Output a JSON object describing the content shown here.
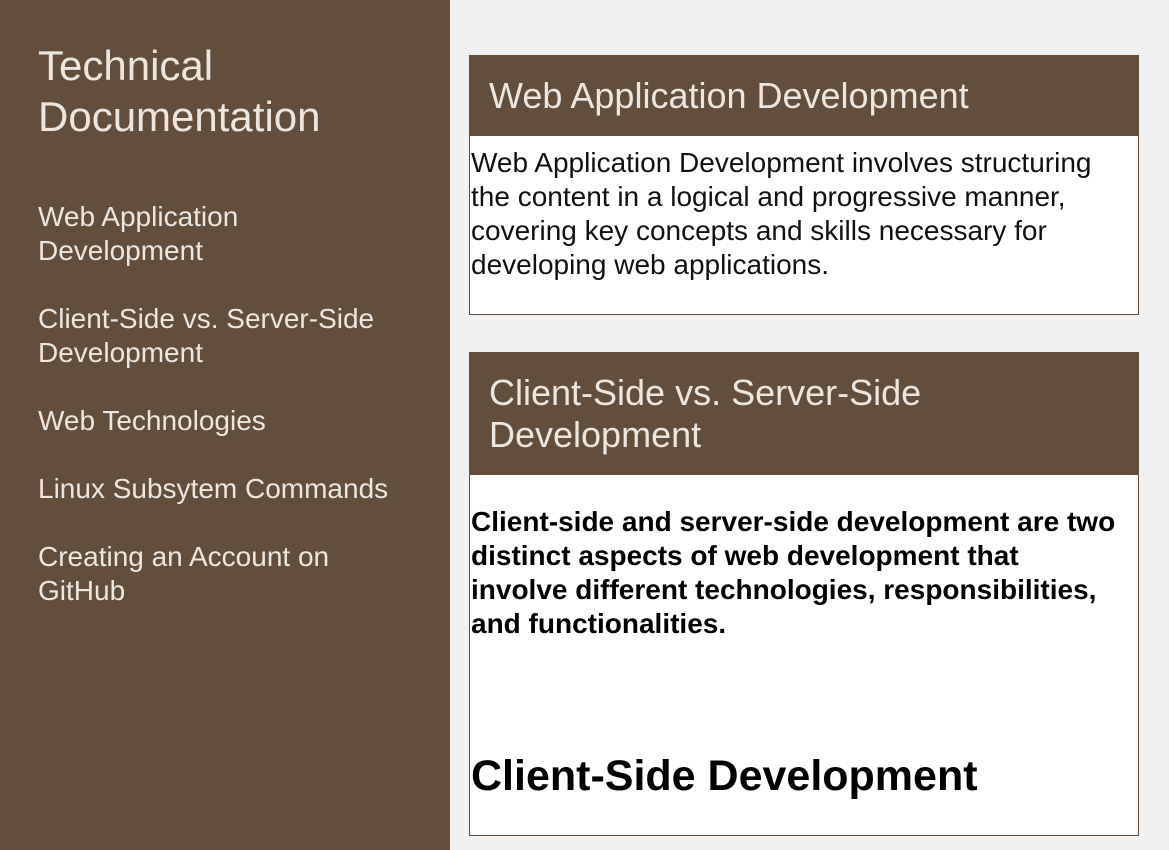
{
  "sidebar": {
    "title": "Technical Documentation",
    "items": [
      {
        "label": "Web Application Development"
      },
      {
        "label": "Client-Side vs. Server-Side Development"
      },
      {
        "label": "Web Technologies"
      },
      {
        "label": "Linux Subsytem Commands"
      },
      {
        "label": "Creating an Account on GitHub"
      }
    ]
  },
  "sections": [
    {
      "title": "Web Application Development",
      "text": "Web Application Development involves structuring the content in a logical and progressive manner, covering key concepts and skills necessary for developing web applications."
    },
    {
      "title": "Client-Side vs. Server-Side Development",
      "text": "Client-side and server-side development are two distinct aspects of web development that involve different technologies, responsibilities, and functionalities.",
      "subheading": "Client-Side Development"
    }
  ],
  "colors": {
    "sidebar_bg": "#634e3b",
    "page_bg": "#f0f0f0",
    "header_text": "#ece6df"
  }
}
